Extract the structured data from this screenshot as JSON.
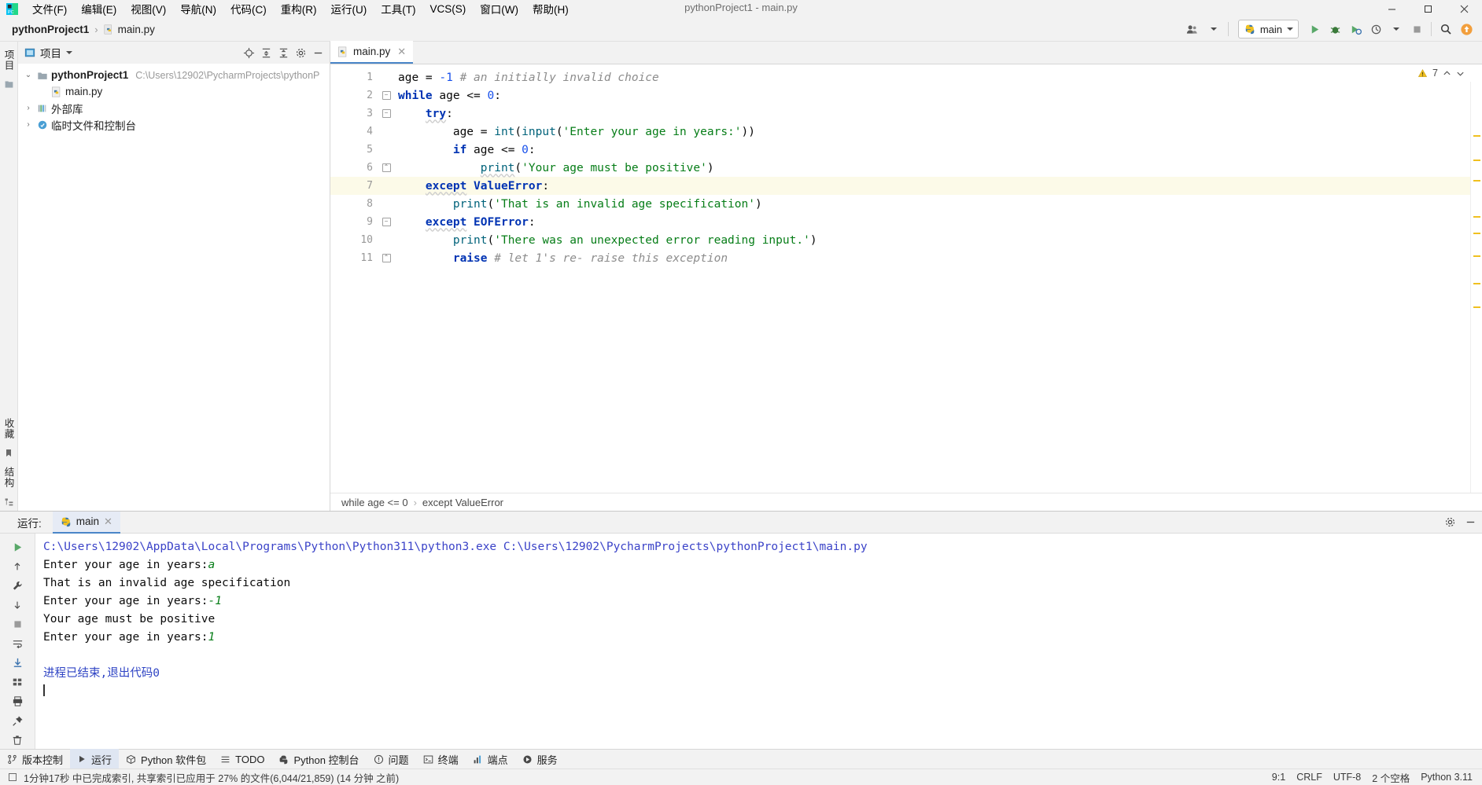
{
  "window": {
    "title": "pythonProject1 - main.py",
    "minimize_label": "—",
    "maximize_label": "❐",
    "close_label": "✕"
  },
  "menu": {
    "items": [
      {
        "label": "文件(F)"
      },
      {
        "label": "编辑(E)"
      },
      {
        "label": "视图(V)"
      },
      {
        "label": "导航(N)"
      },
      {
        "label": "代码(C)"
      },
      {
        "label": "重构(R)"
      },
      {
        "label": "运行(U)"
      },
      {
        "label": "工具(T)"
      },
      {
        "label": "VCS(S)"
      },
      {
        "label": "窗口(W)"
      },
      {
        "label": "帮助(H)"
      }
    ]
  },
  "navbar": {
    "breadcrumbs": [
      {
        "label": "pythonProject1",
        "bold": true
      },
      {
        "label": "main.py",
        "bold": false
      }
    ],
    "separator": "›",
    "run_config": "main",
    "buttons": {
      "run": "运行",
      "debug": "调试",
      "run_coverage": "运行覆盖率",
      "profile": "分析",
      "stop": "停止",
      "search": "搜索",
      "updates": "更新"
    }
  },
  "left_strip": {
    "tabs": [
      {
        "label": "项目"
      },
      {
        "label": "收藏"
      },
      {
        "label": "结构"
      }
    ]
  },
  "project": {
    "panel_title": "项目",
    "header_buttons": {
      "locate": "定位",
      "expand_all": "全部展开",
      "collapse_all": "全部折叠",
      "settings": "设置",
      "hide": "隐藏"
    },
    "tree": [
      {
        "name": "pythonProject1",
        "path": "C:\\Users\\12902\\PycharmProjects\\pythonP",
        "arrow": "⌄",
        "bold": true,
        "indent": 0,
        "icon": "folder-icon"
      },
      {
        "name": "main.py",
        "path": "",
        "arrow": "",
        "bold": false,
        "indent": 1,
        "icon": "python-file-icon"
      },
      {
        "name": "外部库",
        "path": "",
        "arrow": "›",
        "bold": false,
        "indent": 0,
        "icon": "library-icon"
      },
      {
        "name": "临时文件和控制台",
        "path": "",
        "arrow": "›",
        "bold": false,
        "indent": 0,
        "icon": "scratch-icon"
      }
    ]
  },
  "editor": {
    "tab": {
      "label": "main.py",
      "close": "✕"
    },
    "warning_count": "7",
    "warning_icon": "warning-triangle-icon",
    "breadcrumb": [
      "while age <= 0",
      "except ValueError"
    ],
    "breadcrumb_sep": "›",
    "lines": [
      {
        "n": "1",
        "fold": "",
        "current": false
      },
      {
        "n": "2",
        "fold": "-",
        "current": false
      },
      {
        "n": "3",
        "fold": "-",
        "current": false
      },
      {
        "n": "4",
        "fold": "",
        "current": false
      },
      {
        "n": "5",
        "fold": "",
        "current": false
      },
      {
        "n": "6",
        "fold": "^",
        "current": false
      },
      {
        "n": "7",
        "fold": "",
        "current": true
      },
      {
        "n": "8",
        "fold": "",
        "current": false
      },
      {
        "n": "9",
        "fold": "-",
        "current": false
      },
      {
        "n": "10",
        "fold": "",
        "current": false
      },
      {
        "n": "11",
        "fold": "^",
        "current": false
      }
    ],
    "code_plain": [
      "age = -1 # an initially invalid choice",
      "while age <= 0:",
      "    try:",
      "        age = int(input('Enter your age in years:'))",
      "        if age <= 0:",
      "            print('Your age must be positive')",
      "    except ValueError:",
      "        print('That is an invalid age specification')",
      "    except EOFError:",
      "        print('There was an unexpected error reading input.')",
      "        raise # let 1's re- raise this exception"
    ]
  },
  "run_panel": {
    "label": "运行:",
    "tab": {
      "label": "main",
      "close": "✕"
    },
    "tools": {
      "rerun": "重新运行",
      "settings": "配置",
      "stop": "停止",
      "trace": "跟踪",
      "scroll_to_end": "滚动到末尾",
      "soft_wrap": "软换行",
      "print": "打印",
      "pin": "固定",
      "clear": "清除全部"
    },
    "console": [
      {
        "kind": "cmd",
        "text": "C:\\Users\\12902\\AppData\\Local\\Programs\\Python\\Python311\\python3.exe C:\\Users\\12902\\PycharmProjects\\pythonProject1\\main.py"
      },
      {
        "kind": "io",
        "prompt": "Enter your age in years:",
        "input": "a"
      },
      {
        "kind": "out",
        "text": "That is an invalid age specification"
      },
      {
        "kind": "io",
        "prompt": "Enter your age in years:",
        "input": "-1"
      },
      {
        "kind": "out",
        "text": "Your age must be positive"
      },
      {
        "kind": "io",
        "prompt": "Enter your age in years:",
        "input": "1"
      },
      {
        "kind": "blank",
        "text": ""
      },
      {
        "kind": "exit",
        "text": "进程已结束,退出代码0"
      }
    ]
  },
  "bottom_bar": {
    "items": [
      {
        "label": "版本控制",
        "icon": "branch-icon",
        "active": false
      },
      {
        "label": "运行",
        "icon": "play-icon",
        "active": true
      },
      {
        "label": "Python 软件包",
        "icon": "package-icon",
        "active": false
      },
      {
        "label": "TODO",
        "icon": "list-icon",
        "active": false
      },
      {
        "label": "Python 控制台",
        "icon": "python-icon",
        "active": false
      },
      {
        "label": "问题",
        "icon": "problems-icon",
        "active": false
      },
      {
        "label": "终端",
        "icon": "terminal-icon",
        "active": false
      },
      {
        "label": "端点",
        "icon": "endpoints-icon",
        "active": false
      },
      {
        "label": "服务",
        "icon": "services-icon",
        "active": false
      }
    ]
  },
  "status_bar": {
    "left_text": "1分钟17秒 中已完成索引, 共享索引已应用于 27% 的文件(6,044/21,859)  (14 分钟 之前)",
    "right": [
      {
        "label": "9:1"
      },
      {
        "label": "CRLF"
      },
      {
        "label": "UTF-8"
      },
      {
        "label": "2 个空格"
      },
      {
        "label": "Python 3.11"
      }
    ]
  },
  "colors": {
    "accent": "#4a86c8",
    "keyword": "#0033b3",
    "string": "#067d17",
    "number": "#1750eb",
    "comment": "#8c8c8c",
    "function": "#00627a",
    "current_line": "#fcfae8"
  }
}
